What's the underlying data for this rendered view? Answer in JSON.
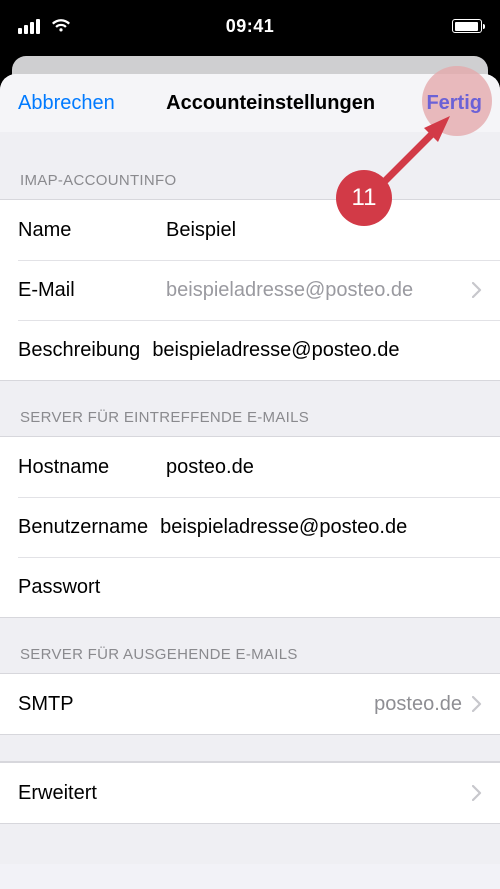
{
  "status": {
    "time": "09:41"
  },
  "nav": {
    "cancel": "Abbrechen",
    "title": "Accounteinstellungen",
    "done": "Fertig"
  },
  "sections": {
    "imap": {
      "header": "IMAP-ACCOUNTINFO",
      "name_label": "Name",
      "name_value": "Beispiel",
      "email_label": "E-Mail",
      "email_value": "beispieladresse@posteo.de",
      "desc_label": "Beschreibung",
      "desc_value": "beispieladresse@posteo.de"
    },
    "incoming": {
      "header": "SERVER FÜR EINTREFFENDE E-MAILS",
      "host_label": "Hostname",
      "host_value": "posteo.de",
      "user_label": "Benutzername",
      "user_value": "beispieladresse@posteo.de",
      "pass_label": "Passwort",
      "pass_value": ""
    },
    "outgoing": {
      "header": "SERVER FÜR AUSGEHENDE E-MAILS",
      "smtp_label": "SMTP",
      "smtp_value": "posteo.de"
    },
    "advanced": {
      "label": "Erweitert"
    }
  },
  "annotation": {
    "number": "11"
  }
}
